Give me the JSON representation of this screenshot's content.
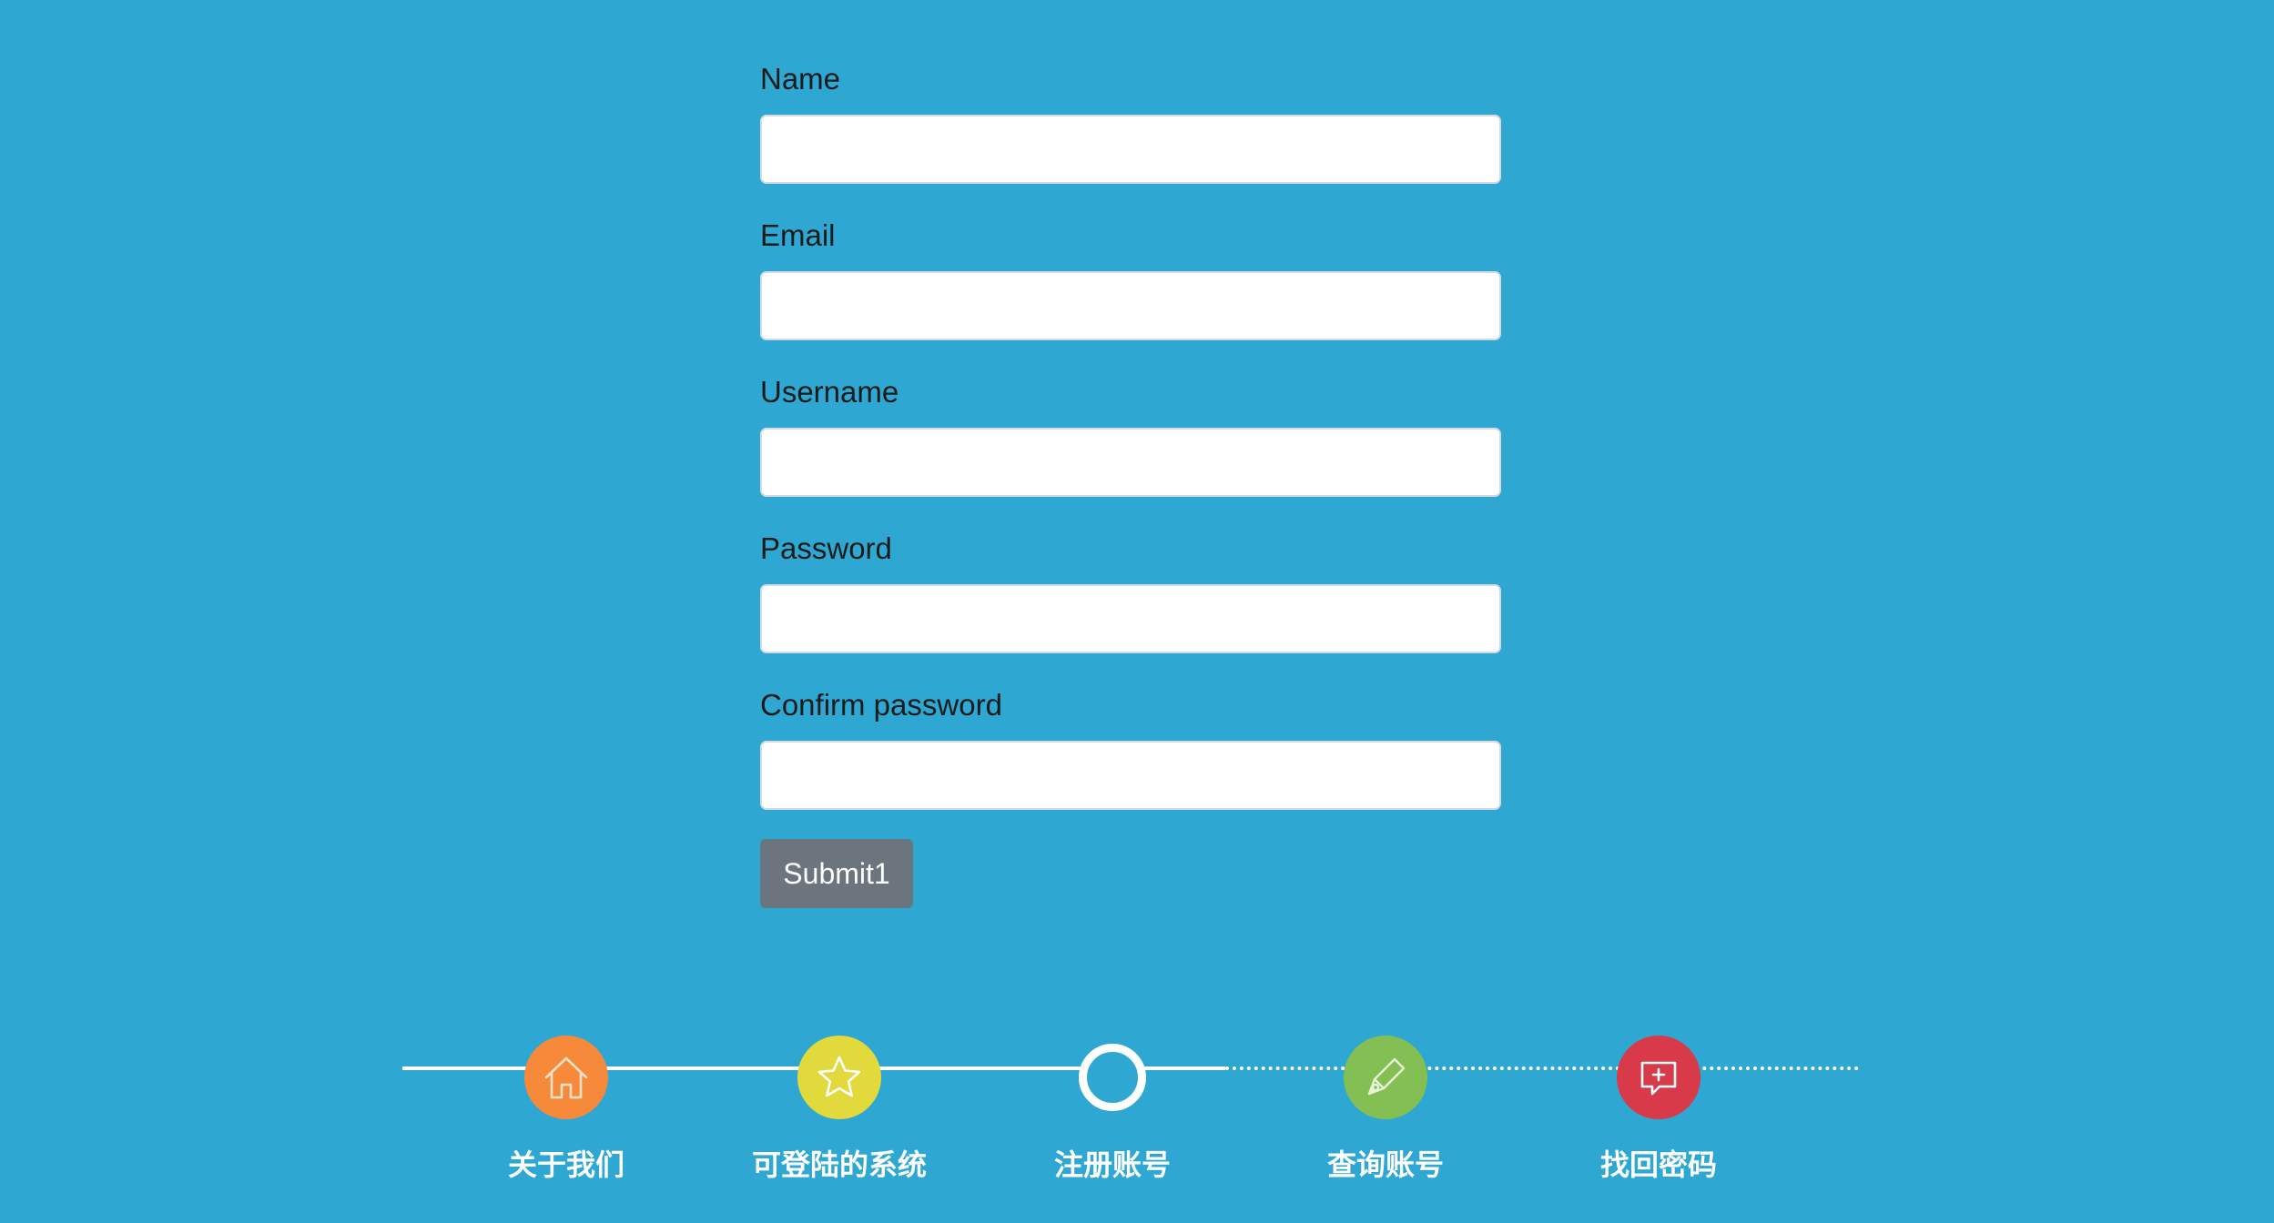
{
  "form": {
    "fields": [
      {
        "label": "Name",
        "value": "",
        "placeholder": ""
      },
      {
        "label": "Email",
        "value": "",
        "placeholder": ""
      },
      {
        "label": "Username",
        "value": "",
        "placeholder": ""
      },
      {
        "label": "Password",
        "value": "",
        "placeholder": ""
      },
      {
        "label": "Confirm password",
        "value": "",
        "placeholder": ""
      }
    ],
    "submit_label": "Submit1"
  },
  "steps": {
    "current_index": 2,
    "items": [
      {
        "label": "关于我们",
        "icon": "home-icon",
        "color": "#f7893b",
        "state": "done"
      },
      {
        "label": "可登陆的系统",
        "icon": "star-icon",
        "color": "#e2d93c",
        "state": "done"
      },
      {
        "label": "注册账号",
        "icon": "current-step-icon",
        "color": "#ffffff",
        "state": "current"
      },
      {
        "label": "查询账号",
        "icon": "pen-icon",
        "color": "#84bf53",
        "state": "pending"
      },
      {
        "label": "找回密码",
        "icon": "message-plus-icon",
        "color": "#d83a4a",
        "state": "pending"
      }
    ]
  },
  "colors": {
    "background": "#2ea7d2",
    "submit_button": "#6c757d"
  }
}
